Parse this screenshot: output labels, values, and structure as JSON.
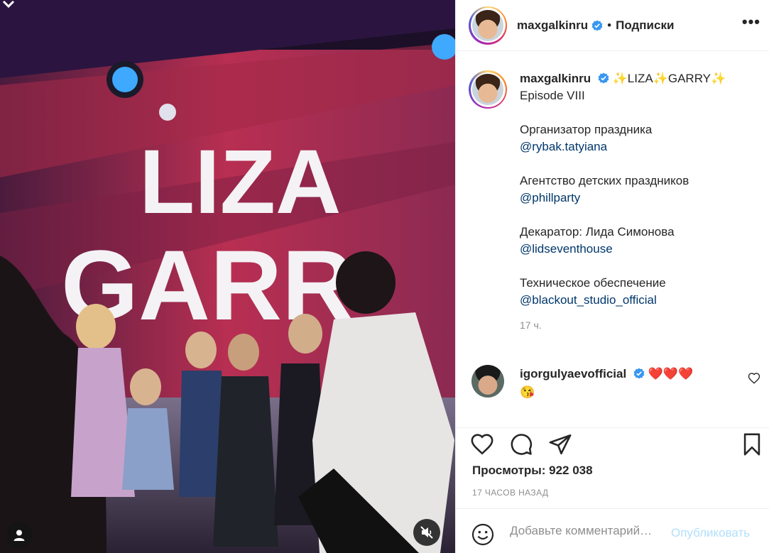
{
  "post": {
    "username": "maxgalkinru",
    "follow_status": "Подписки",
    "more_label": "•••"
  },
  "caption": {
    "username": "maxgalkinru",
    "title_parts": [
      "✨",
      "LIZA",
      "✨",
      "GARRY",
      "✨"
    ],
    "episode": "Episode VIII",
    "blocks": [
      {
        "label": "Организатор праздника",
        "mention": "@rybak.tatyiana"
      },
      {
        "label": "Агентство детских праздников",
        "mention": "@phillparty"
      },
      {
        "label": "Декаратор: Лида Симонова",
        "mention": "@lidseventhouse"
      },
      {
        "label": "Техническое обеспечение",
        "mention": "@blackout_studio_official"
      }
    ],
    "time": "17 ч."
  },
  "comment": {
    "username": "igorgulyaevofficial",
    "hearts": "❤️❤️❤️",
    "emoji": "😘"
  },
  "stats": {
    "views": "Просмотры: 922 038",
    "ago": "17 ЧАСОВ НАЗАД"
  },
  "add_comment": {
    "placeholder": "Добавьте комментарий…",
    "publish_label": "Опубликовать"
  },
  "media": {
    "banner_text_1": "LIZA",
    "banner_text_2": "GARR"
  },
  "icons": {
    "verified": "verified-badge-icon",
    "like": "heart-outline-icon",
    "comment": "speech-bubble-icon",
    "share": "paper-plane-icon",
    "save": "bookmark-icon",
    "emoji": "smiley-icon",
    "mute": "speaker-muted-icon",
    "tag": "user-tag-icon"
  },
  "colors": {
    "link": "#00376b",
    "publish_disabled": "#b2dffc",
    "verified": "#3897f0",
    "heart": "#e0112b"
  }
}
